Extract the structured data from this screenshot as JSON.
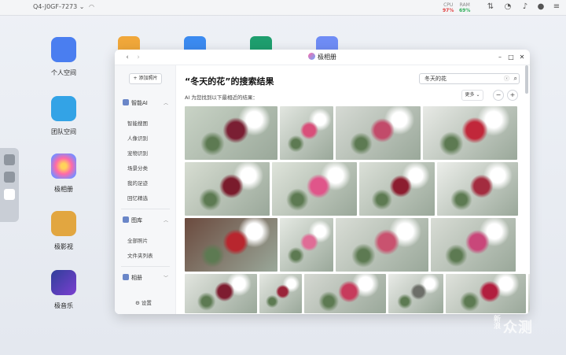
{
  "topbar": {
    "device_name": "Q4-J0GF-7273 ⌄",
    "cpu_label": "CPU",
    "cpu_value": "97%",
    "ram_label": "RAM",
    "ram_value": "69%"
  },
  "desktop": {
    "apps": [
      {
        "label": "个人空间",
        "icon": "folder-icon",
        "color": "#4a7ef0"
      },
      {
        "label": "团队空间",
        "icon": "team-folder-icon",
        "color": "#33a3e6"
      },
      {
        "label": "极相册",
        "icon": "photos-icon",
        "color": "#ff6aa8"
      },
      {
        "label": "极影视",
        "icon": "video-icon",
        "color": "#e2a640"
      },
      {
        "label": "极音乐",
        "icon": "music-icon",
        "color": "#3b5bd8"
      }
    ]
  },
  "window": {
    "title": "极相册",
    "sidebar": {
      "add_button": "+ 添加照片",
      "smart_ai": "智能AI",
      "smart_items": [
        "智能搜图",
        "人像识别",
        "宠物识别",
        "场景分类",
        "我的足迹",
        "回忆精选"
      ],
      "library": "图库",
      "library_items": [
        "全部照片",
        "文件夹列表"
      ],
      "albums": "相册",
      "settings": "设置"
    },
    "main": {
      "heading": "“冬天的花”的搜索结果",
      "search_value": "冬天的花",
      "subtext": "AI 为您找到以下最相近的结果：",
      "more": "更多 ⌄"
    }
  },
  "photos": [
    {
      "c1": "#c9d3c6",
      "c2": "#7a1f33"
    },
    {
      "c1": "#e2e6e0",
      "c2": "#d94f7a"
    },
    {
      "c1": "#d6dad4",
      "c2": "#c24b6a"
    },
    {
      "c1": "#e8eae6",
      "c2": "#c1273a"
    },
    {
      "c1": "#d7ddd2",
      "c2": "#7a1b2c"
    },
    {
      "c1": "#dfe4db",
      "c2": "#e0558a"
    },
    {
      "c1": "#dbe0d8",
      "c2": "#8c1d2f"
    },
    {
      "c1": "#eceeea",
      "c2": "#a32c3f"
    },
    {
      "c1": "#6b4a3e",
      "c2": "#b8262e"
    },
    {
      "c1": "#e5e9e3",
      "c2": "#e06c96"
    },
    {
      "c1": "#d9ddd6",
      "c2": "#c9526f"
    },
    {
      "c1": "#d8dcd5",
      "c2": "#c9477a"
    },
    {
      "c1": "#e2e5df",
      "c2": "#7e1d30"
    },
    {
      "c1": "#e4e7e1",
      "c2": "#9a2439"
    },
    {
      "c1": "#d5d8d2",
      "c2": "#c73b5c"
    },
    {
      "c1": "#e9ebe7",
      "c2": "#6d6f69"
    },
    {
      "c1": "#dfe2dc",
      "c2": "#b21f3f"
    },
    {
      "c1": "#e7e9e5",
      "c2": "#8b2d3c"
    }
  ],
  "watermark": {
    "big": "众测",
    "small_top": "新",
    "small_bottom": "浪"
  }
}
